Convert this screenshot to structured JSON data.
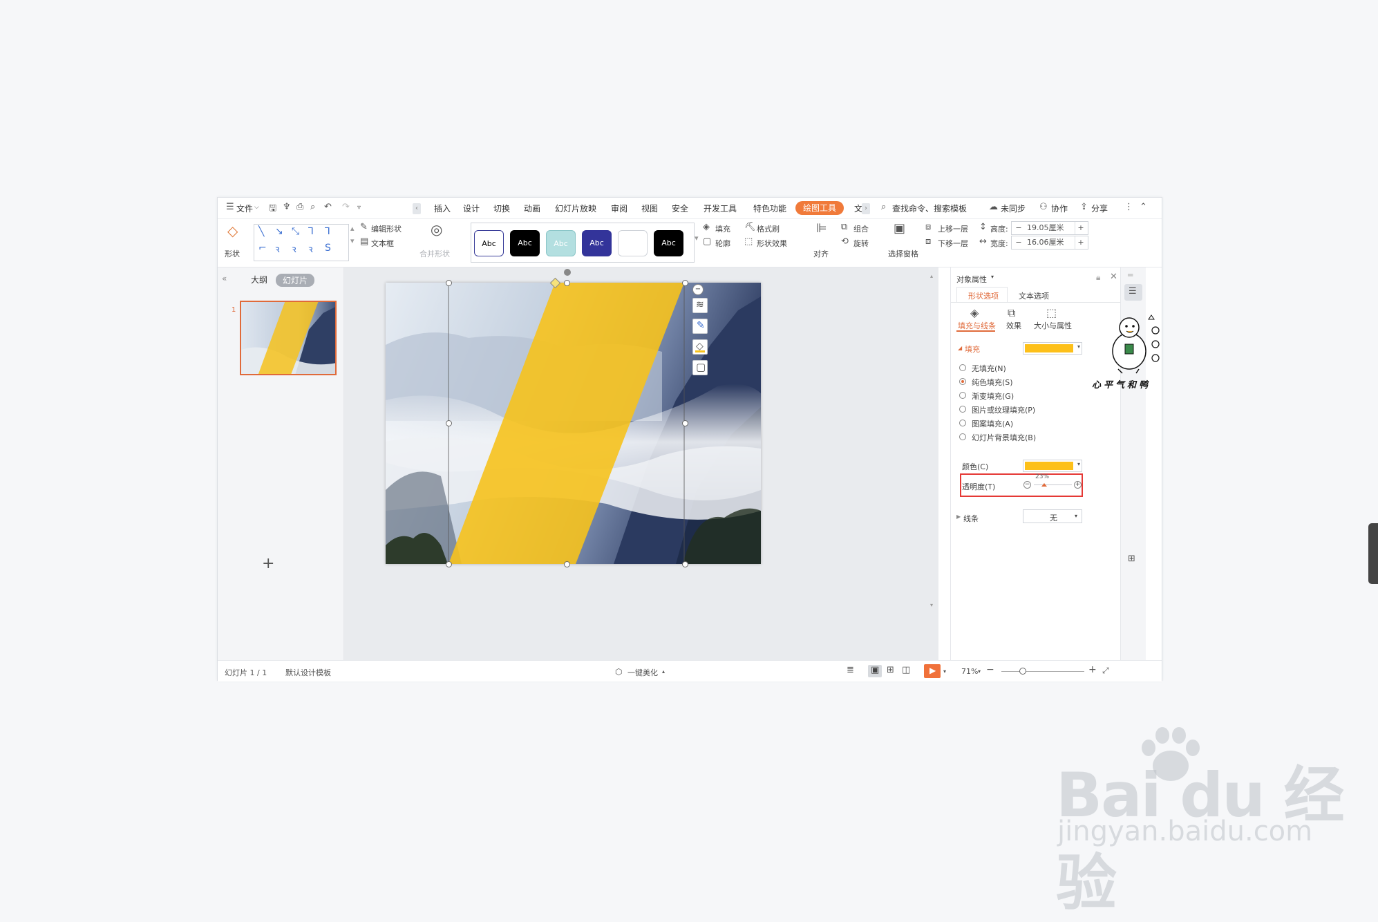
{
  "menubar": {
    "file": "文件",
    "tabs": [
      "插入",
      "设计",
      "切换",
      "动画",
      "幻灯片放映",
      "审阅",
      "视图",
      "安全",
      "开发工具",
      "特色功能"
    ],
    "active_tab": "绘图工具",
    "overflow_tab": "文",
    "search": "查找命令、搜索模板",
    "sync": "未同步",
    "collab": "协作",
    "share": "分享"
  },
  "ribbon": {
    "shape": "形状",
    "edit_shape": "编辑形状",
    "textbox": "文本框",
    "merge_shape": "合并形状",
    "style_samples": [
      "Abc",
      "Abc",
      "Abc",
      "Abc",
      "",
      "Abc"
    ],
    "fill": "填充",
    "outline": "轮廓",
    "format_painter": "格式刷",
    "shape_effect": "形状效果",
    "align": "对齐",
    "group": "组合",
    "rotate": "旋转",
    "selection_pane": "选择窗格",
    "bring_forward": "上移一层",
    "send_backward": "下移一层",
    "height_label": "高度:",
    "height_value": "19.05厘米",
    "width_label": "宽度:",
    "width_value": "16.06厘米"
  },
  "leftpane": {
    "tab_outline": "大纲",
    "tab_slides": "幻灯片",
    "slide_number": "1",
    "add": "+"
  },
  "rightpane": {
    "title": "对象属性",
    "tab_shape": "形状选项",
    "tab_text": "文本选项",
    "sub_fill_line": "填充与线条",
    "sub_effect": "效果",
    "sub_size": "大小与属性",
    "fill_header": "填充",
    "options": [
      "无填充(N)",
      "纯色填充(S)",
      "渐变填充(G)",
      "图片或纹理填充(P)",
      "图案填充(A)",
      "幻灯片背景填充(B)"
    ],
    "selected_option_index": 1,
    "color_label": "颜色(C)",
    "transparency_label": "透明度(T)",
    "transparency_value": "23%",
    "transparency_fraction": 0.23,
    "line_label": "线条",
    "line_value": "无",
    "fill_color": "#fdc01a"
  },
  "statusbar": {
    "slide_info": "幻灯片 1 / 1",
    "template": "默认设计模板",
    "beautify": "一键美化",
    "zoom": "71%"
  },
  "sticker": {
    "caption": "心平气和鸭"
  },
  "watermark": {
    "main": "Bai du 经验",
    "sub": "jingyan.baidu.com"
  },
  "colors": {
    "accent": "#f07a3a",
    "highlight_box": "#e53935",
    "shape_yellow": "#f8c21c"
  }
}
